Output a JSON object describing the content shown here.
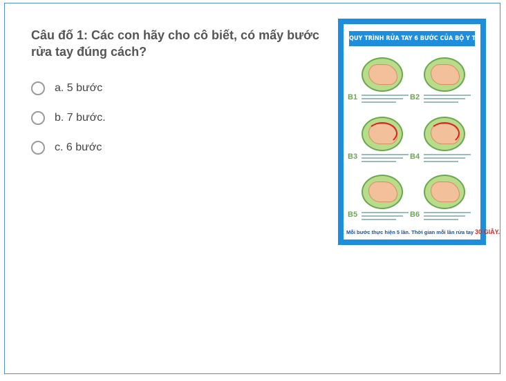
{
  "question": {
    "text": "Câu đố 1: Các con hãy cho cô biết, có mấy bước rửa tay đúng cách?"
  },
  "options": [
    {
      "label": "a. 5 bước",
      "selected": false
    },
    {
      "label": "b. 7 bước.",
      "selected": false
    },
    {
      "label": "c. 6 bước",
      "selected": false
    }
  ],
  "poster": {
    "title": "QUY TRÌNH RỬA TAY 6 BƯỚC CỦA BỘ Y TẾ",
    "steps": [
      "B1",
      "B2",
      "B3",
      "B4",
      "B5",
      "B6"
    ],
    "footer": "Mỗi bước thực hiện 5 lần. Thời gian mỗi lần rửa tay",
    "footer_highlight": "30 GIÂY.",
    "colors": {
      "frame": "#1e8ddb",
      "highlight": "#d7261e",
      "step_label": "#6aa84f"
    }
  }
}
